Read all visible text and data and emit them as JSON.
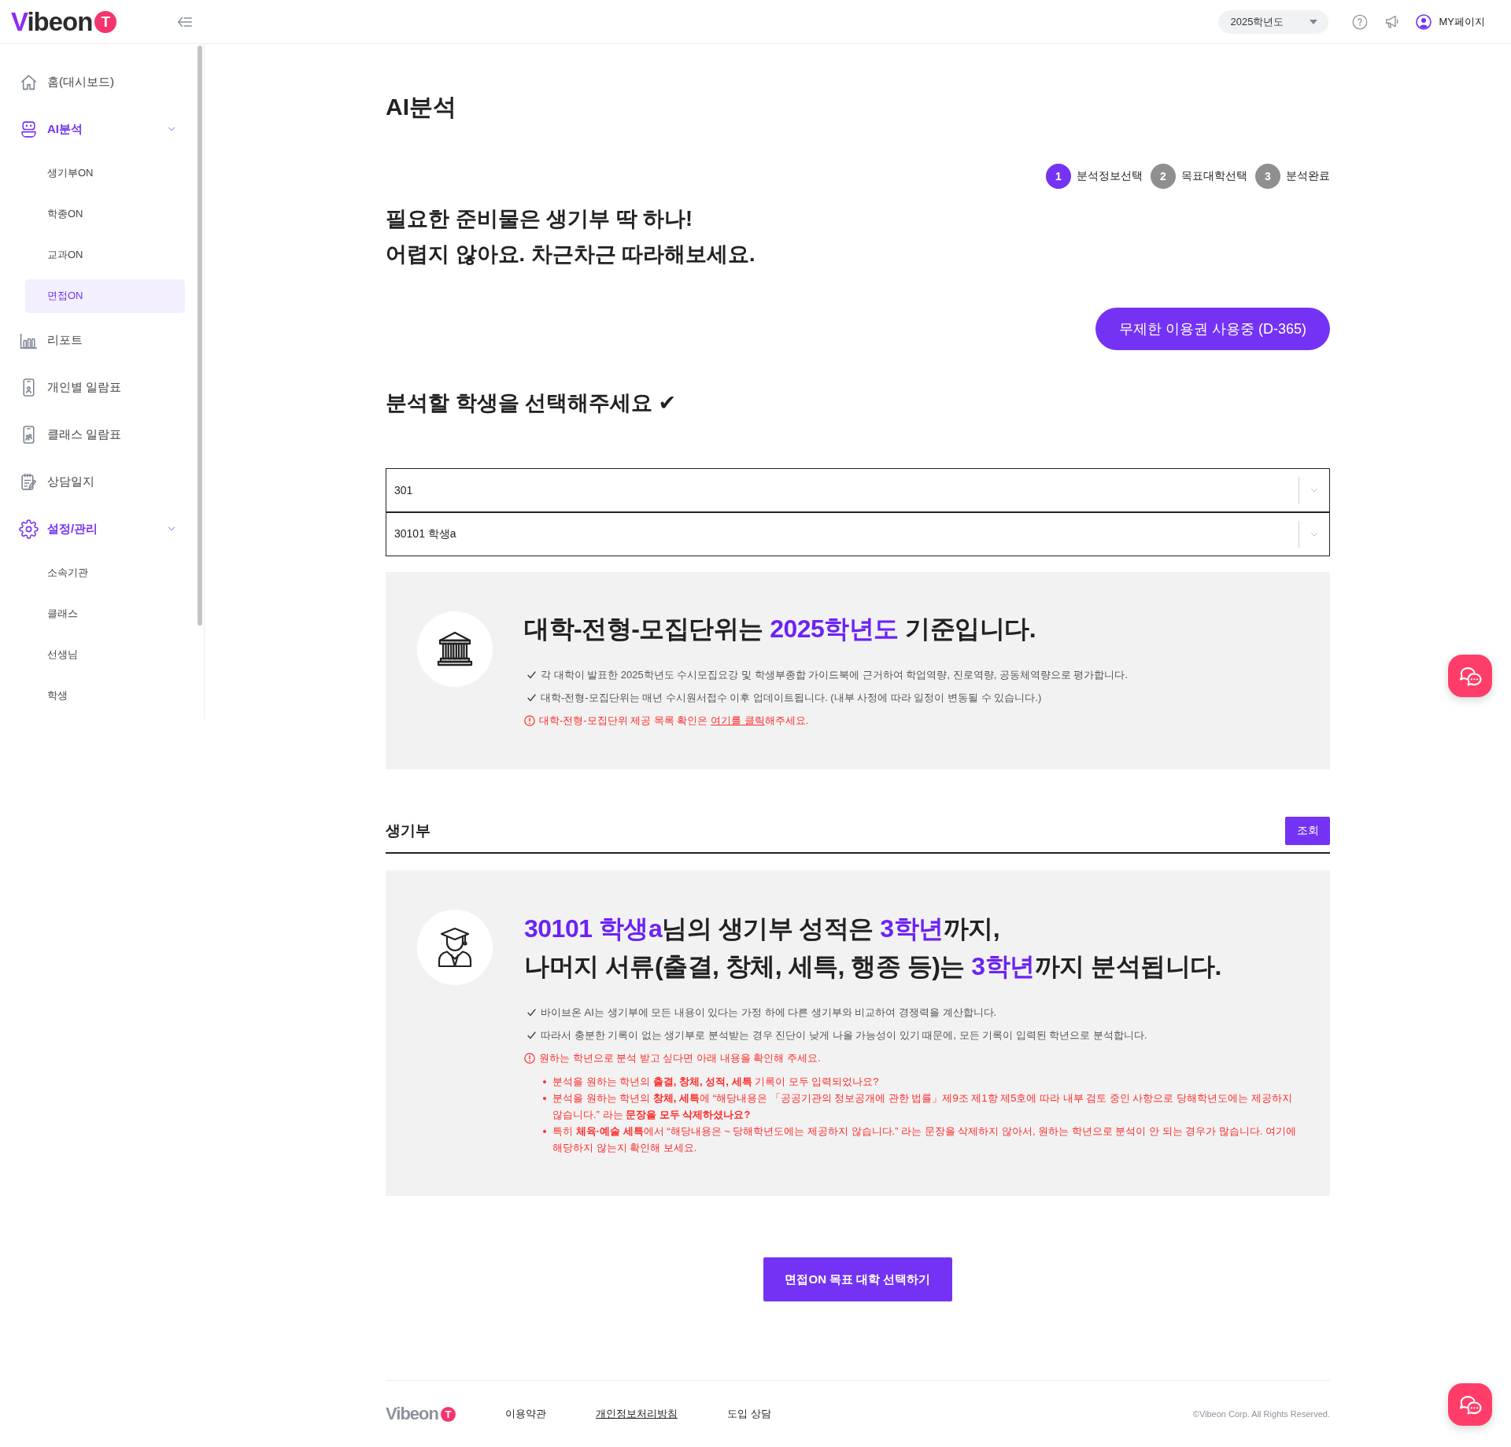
{
  "topbar": {
    "logo": {
      "wordmark": "Vibeon",
      "badge": "T"
    },
    "year_select": {
      "value": "2025학년도"
    },
    "mypage_link": {
      "label": "MY페이지"
    }
  },
  "sidebar": {
    "items": [
      {
        "label": "홈(대시보드)",
        "selected": false
      },
      {
        "label": "AI분석",
        "selected": false,
        "expanded": true,
        "children": [
          {
            "label": "생기부ON",
            "selected": false
          },
          {
            "label": "학종ON",
            "selected": false
          },
          {
            "label": "교과ON",
            "selected": false
          },
          {
            "label": "면접ON",
            "selected": true
          }
        ]
      },
      {
        "label": "리포트",
        "selected": false
      },
      {
        "label": "개인별 일람표",
        "selected": false
      },
      {
        "label": "클래스 일람표",
        "selected": false
      },
      {
        "label": "상담일지",
        "selected": false
      },
      {
        "label": "설정/관리",
        "selected": false,
        "expanded": true,
        "children": [
          {
            "label": "소속기관",
            "selected": false
          },
          {
            "label": "클래스",
            "selected": false
          },
          {
            "label": "선생님",
            "selected": false
          },
          {
            "label": "학생",
            "selected": false
          }
        ]
      }
    ]
  },
  "main": {
    "title": "AI분석",
    "steps": [
      {
        "number": "1",
        "label": "분석정보선택",
        "selected": true
      },
      {
        "number": "2",
        "label": "목표대학선택",
        "selected": false
      },
      {
        "number": "3",
        "label": "분석완료",
        "selected": false
      }
    ],
    "intro": [
      "필요한 준비물은 생기부 딱 하나!",
      "어렵지 않아요. 차근차근 따라해보세요."
    ],
    "pass_button": {
      "label": "무제한 이용권 사용중 (D-365)"
    },
    "student_picker": {
      "title": "분석할 학생을 선택해주세요 ✔",
      "selects": [
        {
          "value": "301"
        },
        {
          "value": "30101 학생a"
        }
      ]
    },
    "admission_notice": {
      "title_lines": [
        [
          {
            "text": "대학-전형-모집단위는 ",
            "highlight": false
          },
          {
            "text": "2025학년도",
            "highlight": true
          },
          {
            "text": " 기준입니다.",
            "highlight": false
          }
        ]
      ],
      "notes": [
        {
          "kind": "check",
          "text": "각 대학이 발표한 2025학년도 수시모집요강 및 학생부종합 가이드북에 근거하여 학업역량, 진로역량, 공동체역량으로 평가합니다."
        },
        {
          "kind": "check",
          "text": "대학-전형-모집단위는 매년 수시원서접수 이후 업데이트됩니다. (내부 사정에 따라 일정이 변동될 수 있습니다.)"
        },
        {
          "kind": "warning",
          "text": "대학-전형-모집단위 제공 목록 확인은 ",
          "link": "여기를 클릭",
          "text_after": "해주세요."
        }
      ]
    },
    "record_section": {
      "title": "생기부",
      "button": "조회"
    },
    "record_notice": {
      "title_lines": [
        [
          {
            "text": "30101 학생a",
            "highlight": true
          },
          {
            "text": "님의 생기부 성적은 ",
            "highlight": false
          },
          {
            "text": "3학년",
            "highlight": true
          },
          {
            "text": "까지,",
            "highlight": false
          }
        ],
        [
          {
            "text": "나머지 서류(출결, 창체, 세특, 행종 등)는 ",
            "highlight": false
          },
          {
            "text": "3학년",
            "highlight": true
          },
          {
            "text": "까지 분석됩니다.",
            "highlight": false
          }
        ]
      ],
      "notes": [
        {
          "kind": "check",
          "text": "바이브온 AI는 생기부에 모든 내용이 있다는 가정 하에 다른 생기부와 비교하여 경쟁력을 계산합니다."
        },
        {
          "kind": "check",
          "text": "따라서 충분한 기록이 없는 생기부로 분석받는 경우 진단이 낮게 나올 가능성이 있기 때문에, 모든 기록이 입력된 학년으로 분석합니다."
        },
        {
          "kind": "warning",
          "text": "원하는 학년으로 분석 받고 싶다면 아래 내용을 확인해 주세요.",
          "bullets": [
            "분석을 원하는 학년의 **출결, 창체, 성적, 세특** 기록이 모두 입력되었나요?",
            "분석을 원하는 학년의 **창체, 세특**에 “해당내용은 「공공기관의 정보공개에 관한 법률」제9조 제1항 제5호에 따라 내부 검토 중인 사항으로 당해학년도에는 제공하지 않습니다.” 라는 **문장을 모두 삭제하셨나요?**",
            "특히 **체육·예술 세특**에서 “해당내용은 ~ 당해학년도에는 제공하지 않습니다.” 라는 문장을 삭제하지 않아서, 원하는 학년으로 분석이 안 되는 경우가 많습니다. 여기에 해당하지 않는지 확인해 보세요."
          ]
        }
      ]
    },
    "next_button": {
      "label": "면접ON 목표 대학 선택하기"
    }
  },
  "footer": {
    "logo": {
      "wordmark": "Vibeon",
      "badge": "T"
    },
    "links": [
      {
        "label": "이용약관",
        "underlined": false
      },
      {
        "label": "개인정보처리방침",
        "underlined": true
      },
      {
        "label": "도입 상담",
        "underlined": false
      }
    ],
    "copyright": "©Vibeon Corp. All Rights Reserved."
  }
}
